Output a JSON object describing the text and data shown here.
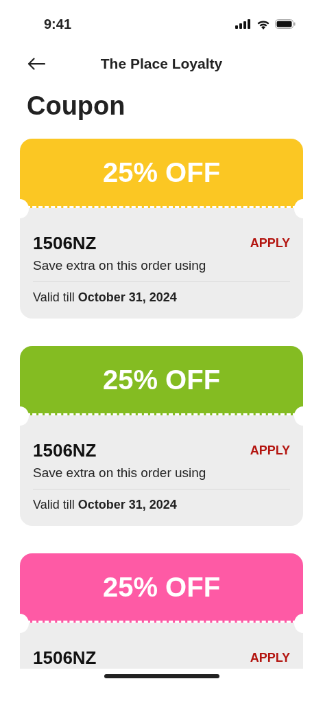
{
  "status_bar": {
    "time": "9:41"
  },
  "header": {
    "title": "The Place Loyalty"
  },
  "page_title": "Coupon",
  "coupons": [
    {
      "color": "#fbc723",
      "discount": "25% OFF",
      "code": "1506NZ",
      "action": "APPLY",
      "description": "Save extra on this order using",
      "validity": "Valid till **October 31, 2024**"
    },
    {
      "color": "#84bc22",
      "discount": "25% OFF",
      "code": "1506NZ",
      "action": "APPLY",
      "description": "Save extra on this order using",
      "validity": "Valid till **October 31, 2024**"
    },
    {
      "color": "#fe5aa5",
      "discount": "25% OFF",
      "code": "1506NZ",
      "action": "APPLY"
    }
  ]
}
